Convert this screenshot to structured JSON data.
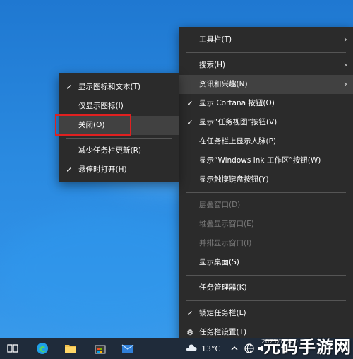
{
  "main_menu": {
    "items": [
      {
        "label": "工具栏(T)",
        "arrow": true
      },
      {
        "label": "搜索(H)",
        "arrow": true
      },
      {
        "label": "资讯和兴趣(N)",
        "arrow": true
      },
      {
        "label": "显示 Cortana 按钮(O)",
        "checked": true
      },
      {
        "label": "显示“任务视图”按钮(V)",
        "checked": true
      },
      {
        "label": "在任务栏上显示人脉(P)"
      },
      {
        "label": "显示“Windows Ink 工作区”按钮(W)"
      },
      {
        "label": "显示触摸键盘按钮(Y)"
      },
      {
        "label": "层叠窗口(D)"
      },
      {
        "label": "堆叠显示窗口(E)"
      },
      {
        "label": "并排显示窗口(I)"
      },
      {
        "label": "显示桌面(S)"
      },
      {
        "label": "任务管理器(K)"
      },
      {
        "label": "锁定任务栏(L)",
        "checked": true
      },
      {
        "label": "任务栏设置(T)"
      }
    ]
  },
  "sub_menu": {
    "items": [
      {
        "label": "显示图标和文本(T)",
        "checked": true
      },
      {
        "label": "仅显示图标(I)"
      },
      {
        "label": "关闭(O)"
      },
      {
        "label": "减少任务栏更新(R)"
      },
      {
        "label": "悬停时打开(H)",
        "checked": true
      }
    ]
  },
  "glyphs": {
    "check": "✓",
    "arrow": "›",
    "gear": "⚙"
  },
  "taskbar": {
    "weather_temp": "13°C",
    "date": "2021/12/20",
    "watermark": "元码手游网"
  },
  "colors": {
    "menu_bg": "#2b2b2b",
    "hover_bg": "#414141",
    "highlight_border": "#e02020",
    "taskbar": "#1f2b3a"
  }
}
